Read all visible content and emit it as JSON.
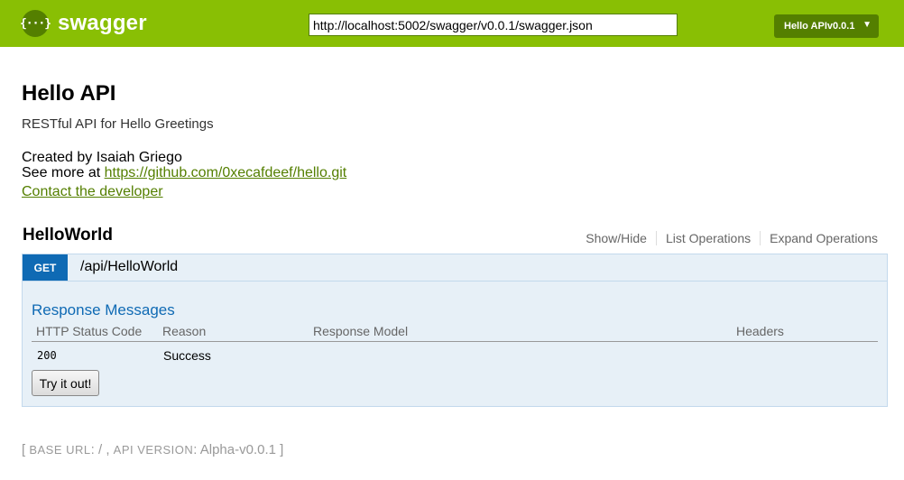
{
  "header": {
    "logo_glyph": "{···}",
    "logo_text": "swagger",
    "url_value": "http://localhost:5002/swagger/v0.0.1/swagger.json",
    "api_select": "Hello APIv0.0.1",
    "caret": "▼",
    "accent": "#89bf04",
    "accent_dark": "#547f00"
  },
  "info": {
    "title": "Hello API",
    "description": "RESTful API for Hello Greetings",
    "created_by": "Created by Isaiah Griego",
    "see_more_prefix": "See more at ",
    "see_more_link": "https://github.com/0xecafdeef/hello.git",
    "contact": "Contact the developer"
  },
  "resource": {
    "name": "HelloWorld",
    "actions": [
      "Show/Hide",
      "List Operations",
      "Expand Operations"
    ],
    "operation": {
      "method": "GET",
      "path": "/api/HelloWorld",
      "method_color": "#0f6ab4",
      "response_title": "Response Messages",
      "columns": [
        "HTTP Status Code",
        "Reason",
        "Response Model",
        "Headers"
      ],
      "rows": [
        {
          "code": "200",
          "reason": "Success"
        }
      ],
      "try_button": "Try it out!"
    }
  },
  "footer": {
    "open": "[ ",
    "base_url_label": "BASE URL",
    "base_url_value": ": / , ",
    "api_version_label": "API VERSION",
    "api_version_value": ": Alpha-v0.0.1 ",
    "close": "]"
  }
}
